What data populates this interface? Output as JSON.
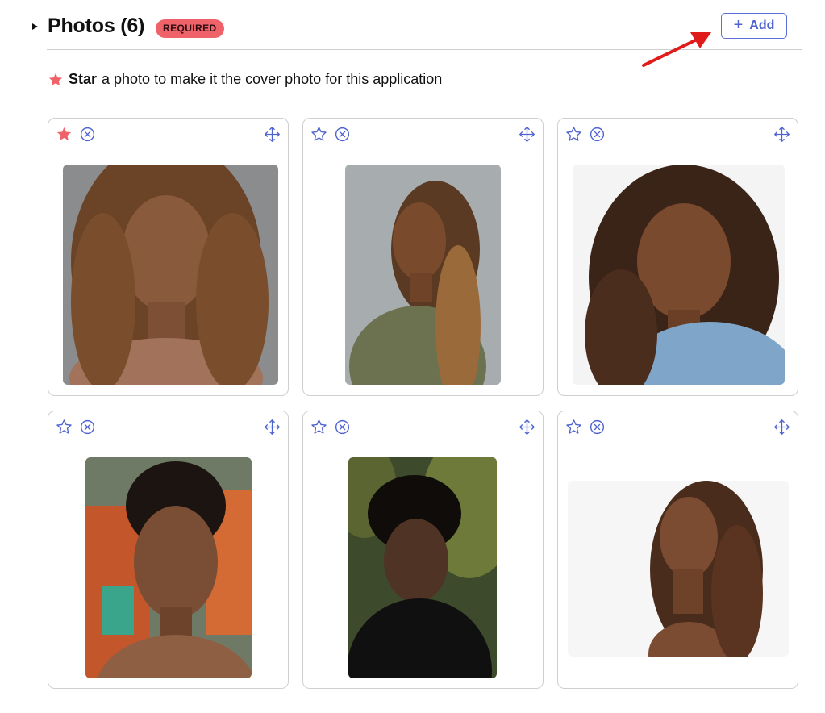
{
  "header": {
    "title": "Photos (6)",
    "badge": "REQUIRED",
    "add_label": "Add"
  },
  "hint": {
    "bold": "Star",
    "text": "a photo to make it the cover photo for this application"
  },
  "colors": {
    "accent": "#4e63cf",
    "star_active": "#f0626a",
    "badge_bg": "#f0626a",
    "annotation_arrow": "#e01b1b"
  },
  "photos": [
    {
      "starred": true,
      "star_icon": "star-filled-icon",
      "remove_icon": "remove-circle-icon",
      "move_icon": "move-arrows-icon"
    },
    {
      "starred": false,
      "star_icon": "star-outline-icon",
      "remove_icon": "remove-circle-icon",
      "move_icon": "move-arrows-icon"
    },
    {
      "starred": false,
      "star_icon": "star-outline-icon",
      "remove_icon": "remove-circle-icon",
      "move_icon": "move-arrows-icon"
    },
    {
      "starred": false,
      "star_icon": "star-outline-icon",
      "remove_icon": "remove-circle-icon",
      "move_icon": "move-arrows-icon"
    },
    {
      "starred": false,
      "star_icon": "star-outline-icon",
      "remove_icon": "remove-circle-icon",
      "move_icon": "move-arrows-icon"
    },
    {
      "starred": false,
      "star_icon": "star-outline-icon",
      "remove_icon": "remove-circle-icon",
      "move_icon": "move-arrows-icon"
    }
  ]
}
